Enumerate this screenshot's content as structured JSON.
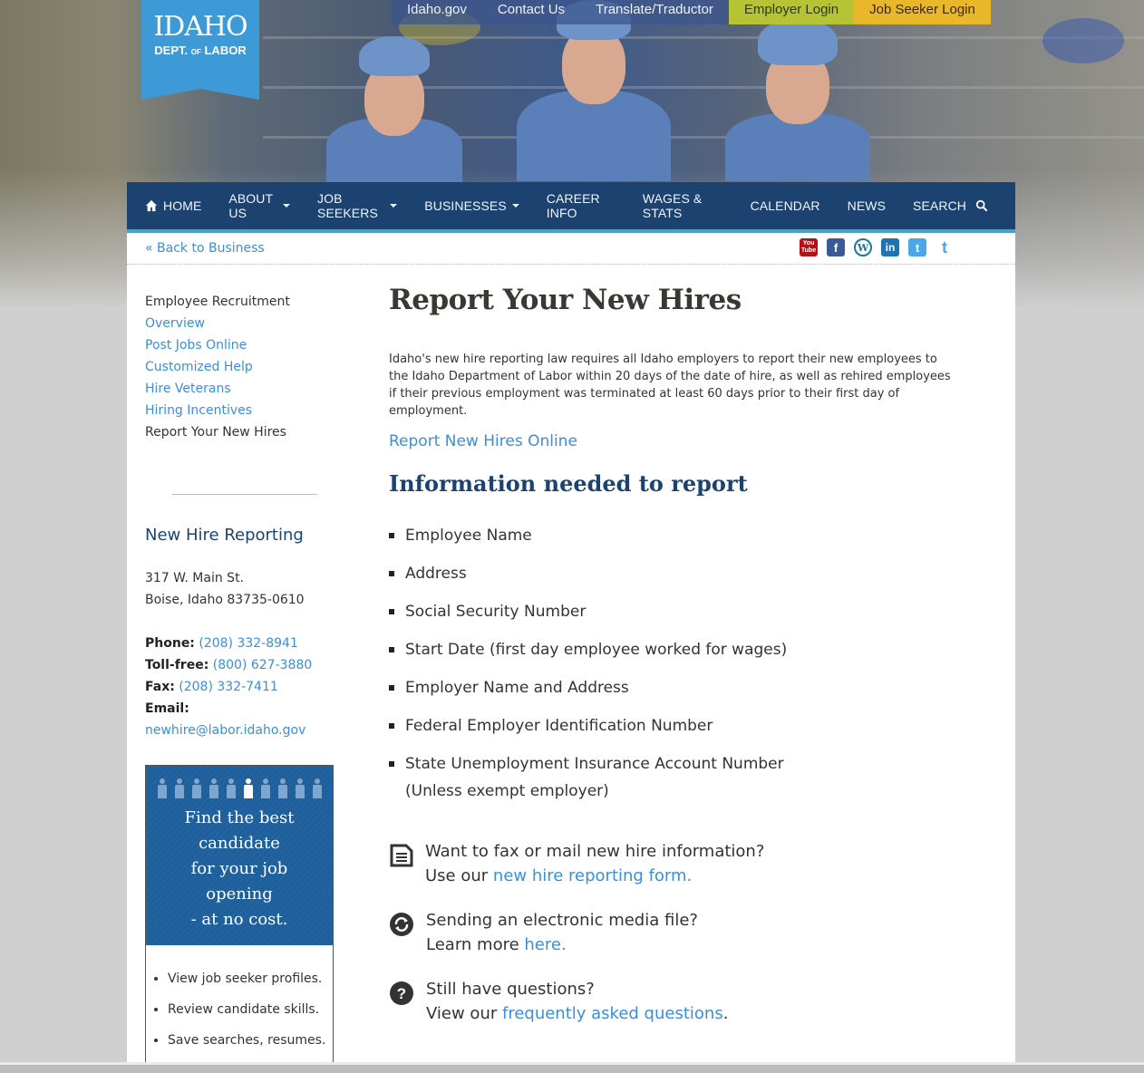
{
  "logo": {
    "line1": "IDAHO",
    "line2_a": "DEPT.",
    "line2_of": "OF",
    "line2_b": "LABOR"
  },
  "utility_nav": [
    {
      "label": "Idaho.gov"
    },
    {
      "label": "Contact Us"
    },
    {
      "label": "Translate/Traductor"
    },
    {
      "label": "Employer Login"
    },
    {
      "label": "Job Seeker Login"
    }
  ],
  "main_nav": {
    "home": "HOME",
    "about": "ABOUT US",
    "job_seekers": "JOB SEEKERS",
    "businesses": "BUSINESSES",
    "career_info": "CAREER INFO",
    "wages": "WAGES & STATS",
    "calendar": "CALENDAR",
    "news": "NEWS",
    "search": "SEARCH"
  },
  "back_link": "« Back to Business",
  "social": {
    "youtube": "You Tube",
    "facebook": "f",
    "wordpress": "W",
    "linkedin": "in",
    "twitter_square": "t",
    "twitter": "t"
  },
  "sidebar": {
    "section_title": "Employee Recruitment",
    "links": [
      "Overview",
      "Post Jobs Online",
      "Customized Help",
      "Hire Veterans",
      "Hiring Incentives"
    ],
    "current": "Report Your New Hires",
    "contact_heading": "New Hire Reporting",
    "address_line1": "317 W. Main St.",
    "address_line2": "Boise, Idaho 83735-0610",
    "phone_label": "Phone:",
    "phone": "(208) 332-8941",
    "tollfree_label": "Toll-free:",
    "tollfree": "(800) 627-3880",
    "fax_label": "Fax:",
    "fax": "(208) 332-7411",
    "email_label": "Email:",
    "email": "newhire@labor.idaho.gov"
  },
  "promo": {
    "lines": [
      "Find the best",
      "candidate",
      "for your job",
      "opening",
      "- at no cost."
    ],
    "bullets": [
      "View job seeker profiles.",
      "Review candidate skills.",
      "Save searches, resumes."
    ]
  },
  "main": {
    "title": "Report Your New Hires",
    "intro": "Idaho's new hire reporting law requires all Idaho employers to report their new employees to the Idaho Department of Labor within 20 days of the date of hire, as well as rehired employees if their previous employment was terminated at least 60 days prior to their first day of employment.",
    "report_online_link": "Report New Hires Online",
    "info_heading": "Information needed to report",
    "requirements": [
      "Employee Name",
      "Address",
      "Social Security Number",
      "Start Date (first day employee worked for wages)",
      "Employer Name and Address",
      "Federal Employer Identification Number",
      "State Unemployment Insurance Account Number"
    ],
    "requirement_note": "(Unless exempt employer)",
    "cta": [
      {
        "line1": "Want to fax or mail new hire information?",
        "prefix": "Use our ",
        "link": "new hire reporting form.",
        "suffix": ""
      },
      {
        "line1": "Sending an electronic media file?",
        "prefix": "Learn more ",
        "link": "here.",
        "suffix": ""
      },
      {
        "line1": "Still have questions?",
        "prefix": "View our ",
        "link": "frequently asked questions",
        "suffix": "."
      }
    ]
  },
  "colors": {
    "nav_bg": "#1c4370",
    "nav_accent": "#4aa3c2",
    "link": "#3a8fd9",
    "logo_bg": "#3e9ad6",
    "employer_login": "#b5c335",
    "job_seeker_login": "#e8b72a"
  }
}
